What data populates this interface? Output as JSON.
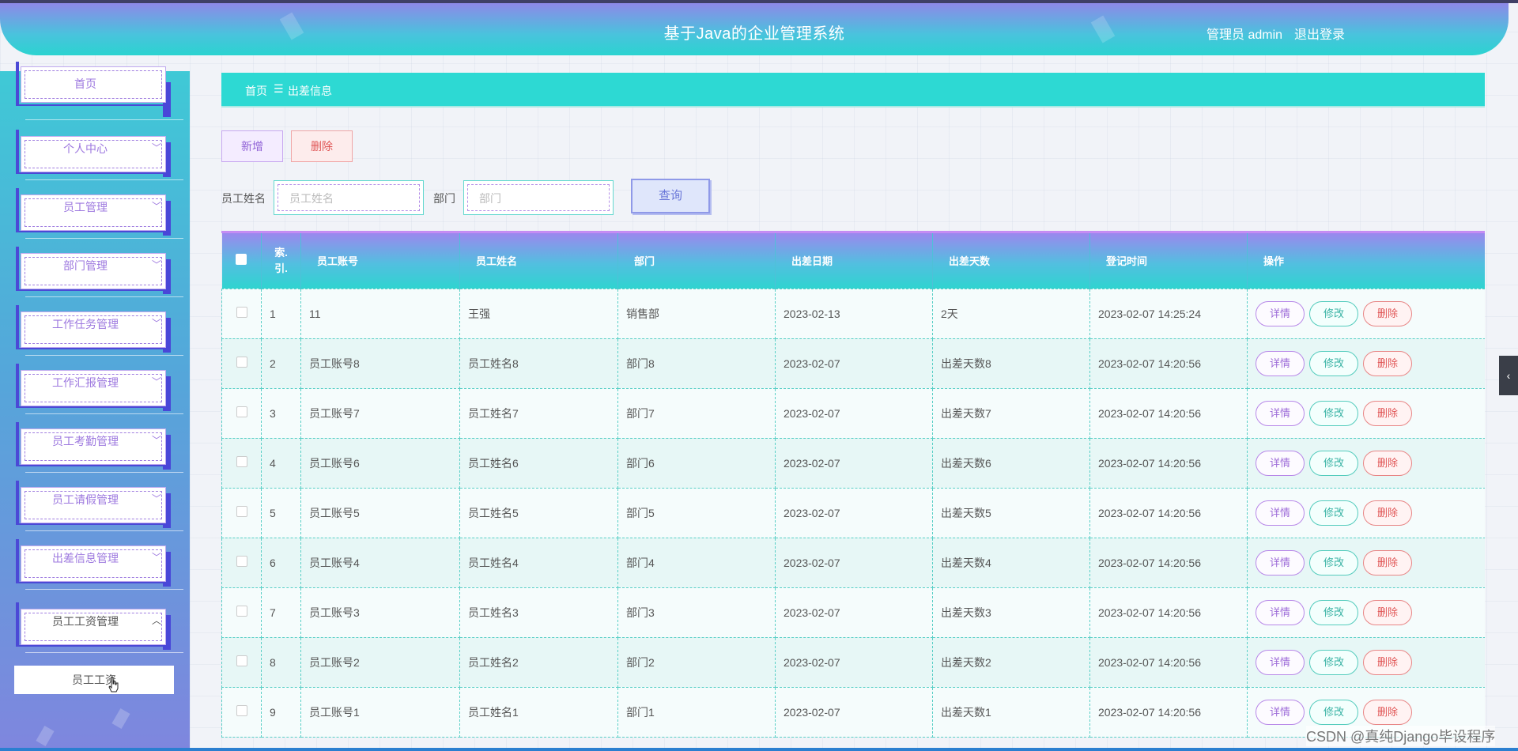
{
  "header": {
    "title": "基于Java的企业管理系统",
    "user_role": "管理员 admin",
    "logout": "退出登录"
  },
  "sidebar": {
    "items": [
      {
        "label": "首页",
        "chevron": ""
      },
      {
        "label": "个人中心",
        "chevron": "﹀"
      },
      {
        "label": "员工管理",
        "chevron": "﹀"
      },
      {
        "label": "部门管理",
        "chevron": "﹀"
      },
      {
        "label": "工作任务管理",
        "chevron": "﹀"
      },
      {
        "label": "工作汇报管理",
        "chevron": "﹀"
      },
      {
        "label": "员工考勤管理",
        "chevron": "﹀"
      },
      {
        "label": "员工请假管理",
        "chevron": "﹀"
      },
      {
        "label": "出差信息管理",
        "chevron": "﹀"
      },
      {
        "label": "员工工资管理",
        "chevron": "︿"
      }
    ],
    "sub_item": "员工工资"
  },
  "breadcrumb": {
    "home": "首页",
    "separator": "☰",
    "current": "出差信息"
  },
  "toolbar": {
    "add_label": "新增",
    "delete_label": "删除",
    "name_label": "员工姓名",
    "name_placeholder": "员工姓名",
    "dept_label": "部门",
    "dept_placeholder": "部门",
    "query_label": "查询"
  },
  "table": {
    "headers": [
      "索引",
      "员工账号",
      "员工姓名",
      "部门",
      "出差日期",
      "出差天数",
      "登记时间",
      "操作"
    ],
    "header_index_line1": "索.",
    "header_index_line2": "引.",
    "rows": [
      {
        "index": "1",
        "account": "11",
        "name": "王强",
        "dept": "销售部",
        "date": "2023-02-13",
        "days": "2天",
        "time": "2023-02-07 14:25:24"
      },
      {
        "index": "2",
        "account": "员工账号8",
        "name": "员工姓名8",
        "dept": "部门8",
        "date": "2023-02-07",
        "days": "出差天数8",
        "time": "2023-02-07 14:20:56"
      },
      {
        "index": "3",
        "account": "员工账号7",
        "name": "员工姓名7",
        "dept": "部门7",
        "date": "2023-02-07",
        "days": "出差天数7",
        "time": "2023-02-07 14:20:56"
      },
      {
        "index": "4",
        "account": "员工账号6",
        "name": "员工姓名6",
        "dept": "部门6",
        "date": "2023-02-07",
        "days": "出差天数6",
        "time": "2023-02-07 14:20:56"
      },
      {
        "index": "5",
        "account": "员工账号5",
        "name": "员工姓名5",
        "dept": "部门5",
        "date": "2023-02-07",
        "days": "出差天数5",
        "time": "2023-02-07 14:20:56"
      },
      {
        "index": "6",
        "account": "员工账号4",
        "name": "员工姓名4",
        "dept": "部门4",
        "date": "2023-02-07",
        "days": "出差天数4",
        "time": "2023-02-07 14:20:56"
      },
      {
        "index": "7",
        "account": "员工账号3",
        "name": "员工姓名3",
        "dept": "部门3",
        "date": "2023-02-07",
        "days": "出差天数3",
        "time": "2023-02-07 14:20:56"
      },
      {
        "index": "8",
        "account": "员工账号2",
        "name": "员工姓名2",
        "dept": "部门2",
        "date": "2023-02-07",
        "days": "出差天数2",
        "time": "2023-02-07 14:20:56"
      },
      {
        "index": "9",
        "account": "员工账号1",
        "name": "员工姓名1",
        "dept": "部门1",
        "date": "2023-02-07",
        "days": "出差天数1",
        "time": "2023-02-07 14:20:56"
      }
    ],
    "actions": {
      "detail": "详情",
      "edit": "修改",
      "delete": "删除"
    }
  },
  "right_tab": "‹",
  "watermark": "CSDN @真纯Django毕设程序",
  "colors": {
    "accent_teal": "#2dd9d3",
    "accent_purple": "#9b88ee",
    "danger": "#e05555"
  }
}
